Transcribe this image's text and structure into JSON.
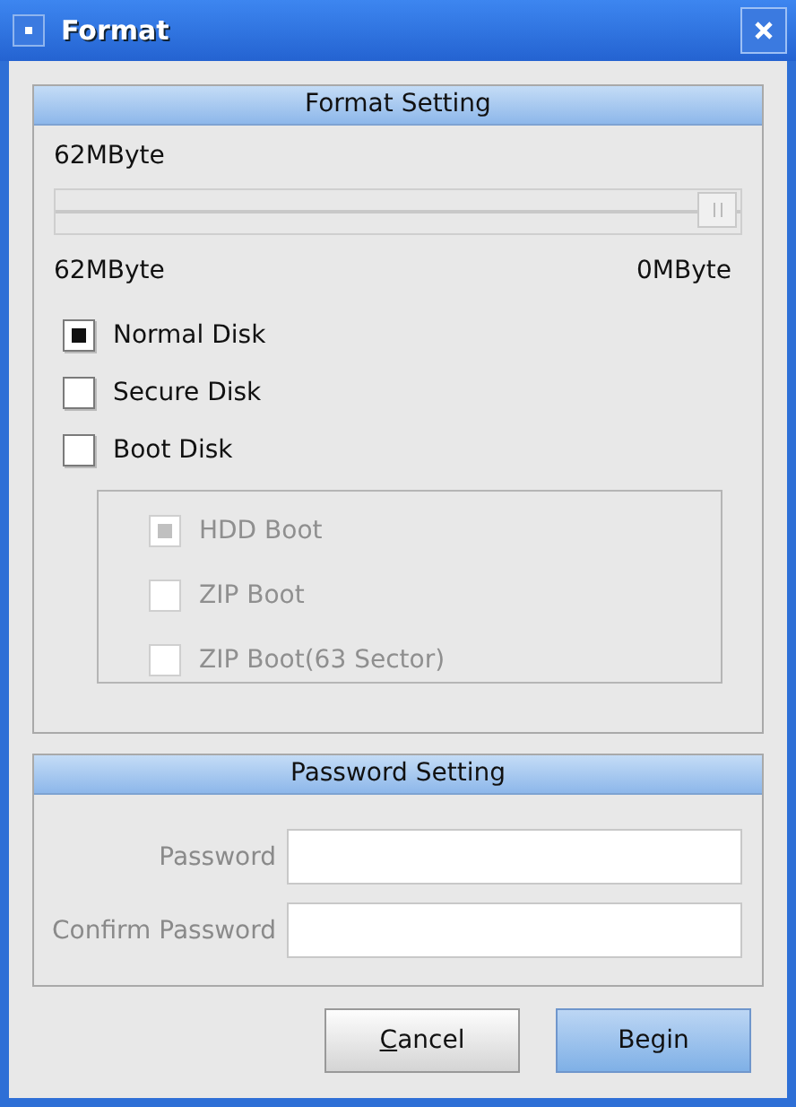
{
  "window": {
    "title": "Format"
  },
  "format_setting": {
    "title": "Format Setting",
    "size_label": "62MByte",
    "slider": {
      "level": 1
    },
    "min_label": "62MByte",
    "max_label": "0MByte",
    "disk_types": [
      {
        "label": "Normal Disk",
        "checked": true,
        "disabled": false
      },
      {
        "label": "Secure Disk",
        "checked": false,
        "disabled": false
      },
      {
        "label": "Boot Disk",
        "checked": false,
        "disabled": false,
        "children": [
          {
            "label": "HDD Boot",
            "checked": true,
            "disabled": true
          },
          {
            "label": "ZIP Boot",
            "checked": false,
            "disabled": true
          },
          {
            "label": "ZIP Boot(63 Sector)",
            "checked": false,
            "disabled": true
          }
        ]
      }
    ]
  },
  "password_setting": {
    "title": "Password Setting",
    "disabled": true,
    "fields": [
      {
        "label": "Password"
      },
      {
        "label": "Confirm Password"
      }
    ]
  },
  "buttons": [
    {
      "label": "Cancel",
      "mnemonic": true,
      "kind": "default"
    },
    {
      "label": "Begin",
      "kind": "primary"
    }
  ]
}
